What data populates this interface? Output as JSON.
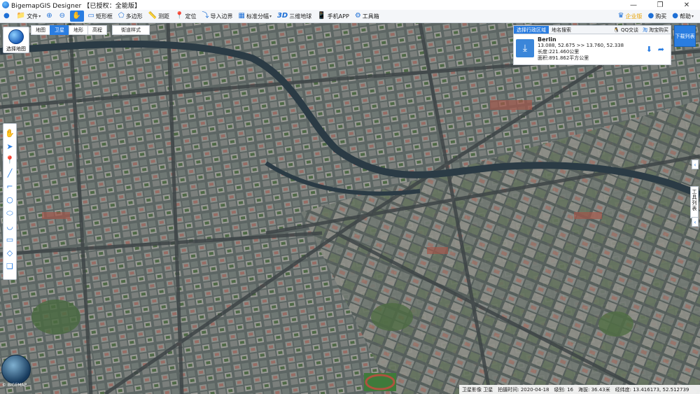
{
  "window": {
    "title": "BigemapGIS Designer 【已授权：全能版】",
    "controls": [
      "—",
      "❐",
      "✕"
    ]
  },
  "toolbar": {
    "items": [
      {
        "label": "文件",
        "icon": "folder-icon",
        "glyph": "📁",
        "dropdown": true
      },
      {
        "label": "",
        "icon": "zoom-in-icon",
        "glyph": "⊕"
      },
      {
        "label": "",
        "icon": "zoom-out-icon",
        "glyph": "⊖"
      },
      {
        "label": "",
        "icon": "pan-hand-icon",
        "glyph": "✋",
        "active": true
      },
      {
        "label": "矩形框",
        "icon": "rectangle-select-icon",
        "glyph": "▭"
      },
      {
        "label": "多边形",
        "icon": "polygon-select-icon",
        "glyph": "⬠"
      },
      {
        "label": "测距",
        "icon": "ruler-icon",
        "glyph": "📏"
      },
      {
        "label": "定位",
        "icon": "location-pin-icon",
        "glyph": "📍"
      },
      {
        "label": "导入边界",
        "icon": "import-boundary-icon",
        "glyph": "⤵"
      },
      {
        "label": "标准分幅",
        "icon": "grid-icon",
        "glyph": "▦",
        "dropdown": true
      },
      {
        "label": "三维地球",
        "icon": "3d-icon",
        "glyph": "3D"
      },
      {
        "label": "手机APP",
        "icon": "mobile-icon",
        "glyph": "📱"
      },
      {
        "label": "工具箱",
        "icon": "gear-icon",
        "glyph": "⚙"
      }
    ],
    "right": [
      {
        "label": "企业版",
        "icon": "vip-crown-icon",
        "glyph": "♛"
      },
      {
        "label": "购买",
        "icon": "cart-icon",
        "glyph": "●"
      },
      {
        "label": "帮助",
        "icon": "help-icon",
        "glyph": "●",
        "dropdown": true
      }
    ]
  },
  "map_selector": {
    "label": "选择地图"
  },
  "map_tabs": [
    {
      "label": "地图",
      "active": false
    },
    {
      "label": "卫星",
      "active": true
    },
    {
      "label": "地形",
      "active": false
    },
    {
      "label": "高程",
      "active": false
    },
    {
      "label": "街道样式",
      "active": false
    }
  ],
  "left_tools": [
    {
      "name": "pan-hand-icon",
      "glyph": "✋"
    },
    {
      "name": "select-arrow-icon",
      "glyph": "➤"
    },
    {
      "name": "marker-icon",
      "glyph": "📍"
    },
    {
      "name": "line-icon",
      "glyph": "╱"
    },
    {
      "name": "polyline-icon",
      "glyph": "⌐"
    },
    {
      "name": "circle-icon",
      "glyph": "○"
    },
    {
      "name": "ellipse-icon",
      "glyph": "⬭"
    },
    {
      "name": "arc-icon",
      "glyph": "◡"
    },
    {
      "name": "rectangle-icon",
      "glyph": "▭"
    },
    {
      "name": "eraser-icon",
      "glyph": "◇"
    },
    {
      "name": "layers-icon",
      "glyph": "❏"
    }
  ],
  "right_panel": {
    "tabs": [
      {
        "label": "选择行政区域",
        "active": true
      },
      {
        "label": "地名搜索",
        "active": false
      }
    ],
    "extras": [
      {
        "label": "QQ交谈",
        "icon": "qq-icon",
        "glyph": "🐧"
      },
      {
        "label": "淘宝购买",
        "icon": "taobao-icon",
        "glyph": "淘"
      }
    ],
    "result": {
      "city": "Berlin",
      "coords": "13.088, 52.675 >> 13.760, 52.338",
      "perimeter": "长度:221.460公里",
      "area": "面积:891.862平方公里"
    },
    "download_button": "下载列表"
  },
  "tools_list_label": "工具列表",
  "map_copyright": "© BIGEMAP",
  "status_bar": {
    "source": "卫星影像 卫星",
    "capture_date": "拍摄时间: 2020-04-18",
    "level": "级别: 16",
    "elevation": "海拔: 36.43米",
    "coordinates": "经纬度: 13.416173, 52.512739"
  },
  "colors": {
    "accent": "#2a7de1",
    "toolbar_bg": "#f4f6f9"
  }
}
